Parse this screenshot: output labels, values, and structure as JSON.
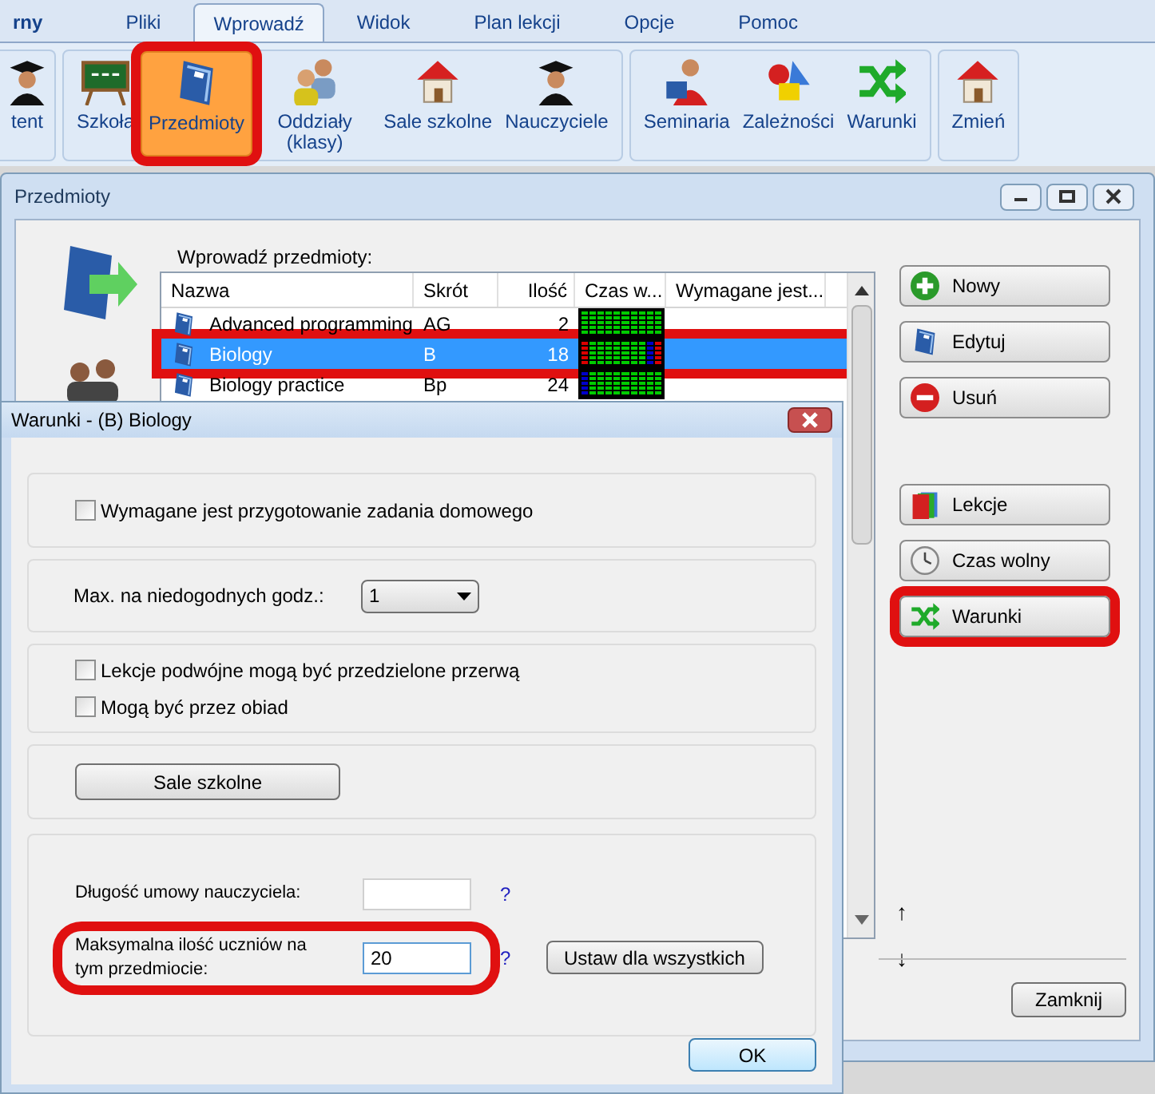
{
  "menu_tabs": [
    {
      "label": "rny",
      "selected": false
    },
    {
      "label": "Pliki",
      "selected": false
    },
    {
      "label": "Wprowadź",
      "selected": true
    },
    {
      "label": "Widok",
      "selected": false
    },
    {
      "label": "Plan lekcji",
      "selected": false
    },
    {
      "label": "Opcje",
      "selected": false
    },
    {
      "label": "Pomoc",
      "selected": false
    }
  ],
  "ribbon_groups": [
    {
      "items": [
        {
          "label": "tent",
          "selected": false,
          "circled": false
        }
      ]
    },
    {
      "items": [
        {
          "label": "Szkoła",
          "selected": false,
          "circled": false
        },
        {
          "label": "Przedmioty",
          "selected": true,
          "circled": true
        },
        {
          "label": "Oddziały (klasy)",
          "selected": false,
          "circled": false
        },
        {
          "label": "Sale szkolne",
          "selected": false,
          "circled": false
        },
        {
          "label": "Nauczyciele",
          "selected": false,
          "circled": false
        }
      ]
    },
    {
      "items": [
        {
          "label": "Seminaria",
          "selected": false,
          "circled": false
        },
        {
          "label": "Zależności",
          "selected": false,
          "circled": false
        },
        {
          "label": "Warunki",
          "selected": false,
          "circled": false
        }
      ]
    },
    {
      "items": [
        {
          "label": "Zmień",
          "selected": false,
          "circled": false
        }
      ]
    }
  ],
  "subjects_window": {
    "title": "Przedmioty",
    "list_label": "Wprowadź przedmioty:",
    "columns": [
      "Nazwa",
      "Skrót",
      "Ilość",
      "Czas w...",
      "Wymagane jest..."
    ],
    "rows": [
      {
        "name": "Advanced programming",
        "short": "AG",
        "count": "2",
        "selected": false,
        "circled": false
      },
      {
        "name": "Biology",
        "short": "B",
        "count": "18",
        "selected": true,
        "circled": true
      },
      {
        "name": "Biology practice",
        "short": "Bp",
        "count": "24",
        "selected": false,
        "circled": false
      }
    ],
    "buttons": [
      {
        "label": "Nowy",
        "circled": false
      },
      {
        "label": "Edytuj",
        "circled": false
      },
      {
        "label": "Usuń",
        "circled": false
      },
      {
        "label": "Lekcje",
        "circled": false
      },
      {
        "label": "Czas wolny",
        "circled": false
      },
      {
        "label": "Warunki",
        "circled": true
      }
    ],
    "up_arrow": "↑",
    "down_arrow": "↓",
    "close_button": "Zamknij"
  },
  "conditions_dialog": {
    "title": "Warunki - (B) Biology",
    "homework": {
      "label": "Wymagane jest przygotowanie zadania domowego",
      "checked": false
    },
    "max_inconvenient": {
      "label": "Max. na niedogodnych godz.:",
      "value": "1"
    },
    "double_lessons": [
      {
        "label": "Lekcje podwójne mogą być przedzielone przerwą",
        "checked": false
      },
      {
        "label": "Mogą być przez obiad",
        "checked": false
      }
    ],
    "rooms_button": "Sale szkolne",
    "fields": [
      {
        "label": "Długość umowy nauczyciela:",
        "help": "?",
        "circled": false
      },
      {
        "label": "Maksymalna ilość uczniów na tym przedmiocie:",
        "value": "20",
        "help": "?",
        "button": "Ustaw dla wszystkich",
        "circled": true
      }
    ],
    "ok_button": "OK"
  }
}
